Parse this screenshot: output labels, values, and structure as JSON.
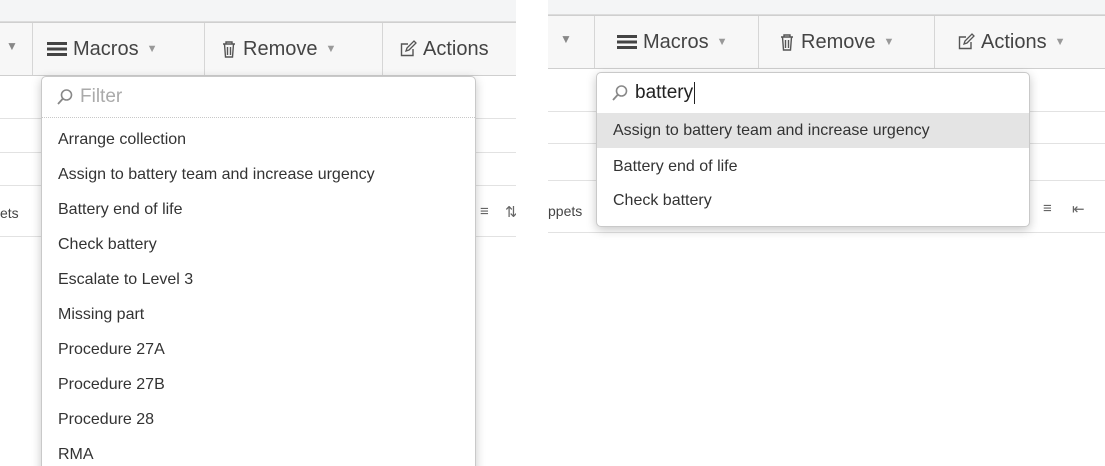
{
  "left": {
    "toolbar": {
      "macros_label": "Macros",
      "remove_label": "Remove",
      "actions_label": "Actions"
    },
    "side_text": "ets",
    "filter": {
      "placeholder": "Filter",
      "value": ""
    },
    "items": [
      "Arrange collection",
      "Assign to battery team and increase urgency",
      "Battery end of life",
      "Check battery",
      "Escalate to Level 3",
      "Missing part",
      "Procedure 27A",
      "Procedure 27B",
      "Procedure 28",
      "RMA"
    ]
  },
  "right": {
    "toolbar": {
      "macros_label": "Macros",
      "remove_label": "Remove",
      "actions_label": "Actions"
    },
    "side_text": "ppets",
    "filter": {
      "value": "battery"
    },
    "items": [
      "Assign to battery team and increase urgency",
      "Battery end of life",
      "Check battery"
    ],
    "active_index": 0
  }
}
